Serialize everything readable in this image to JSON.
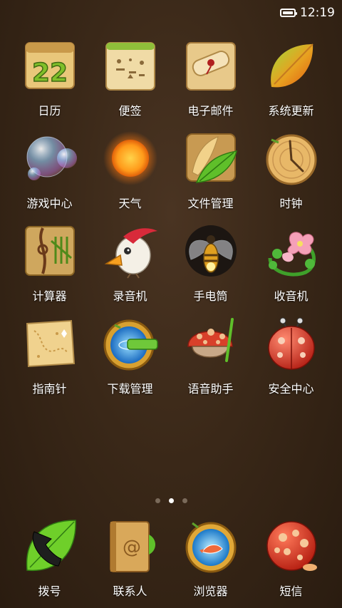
{
  "status_bar": {
    "time": "12:19"
  },
  "apps": [
    [
      {
        "label": "日历",
        "icon": "calendar-icon"
      },
      {
        "label": "便签",
        "icon": "notes-icon"
      },
      {
        "label": "电子邮件",
        "icon": "email-icon"
      },
      {
        "label": "系统更新",
        "icon": "system-update-icon"
      }
    ],
    [
      {
        "label": "游戏中心",
        "icon": "game-center-icon"
      },
      {
        "label": "天气",
        "icon": "weather-icon"
      },
      {
        "label": "文件管理",
        "icon": "file-manager-icon"
      },
      {
        "label": "时钟",
        "icon": "clock-icon"
      }
    ],
    [
      {
        "label": "计算器",
        "icon": "calculator-icon"
      },
      {
        "label": "录音机",
        "icon": "recorder-icon"
      },
      {
        "label": "手电筒",
        "icon": "flashlight-icon"
      },
      {
        "label": "收音机",
        "icon": "radio-icon"
      }
    ],
    [
      {
        "label": "指南针",
        "icon": "compass-icon"
      },
      {
        "label": "下载管理",
        "icon": "download-manager-icon"
      },
      {
        "label": "语音助手",
        "icon": "voice-assistant-icon"
      },
      {
        "label": "安全中心",
        "icon": "security-center-icon"
      }
    ]
  ],
  "calendar_day": "22",
  "page_indicator": {
    "count": 3,
    "active": 1
  },
  "dock": [
    {
      "label": "拨号",
      "icon": "phone-dialer-icon"
    },
    {
      "label": "联系人",
      "icon": "contacts-icon"
    },
    {
      "label": "浏览器",
      "icon": "browser-icon"
    },
    {
      "label": "短信",
      "icon": "sms-icon"
    }
  ]
}
